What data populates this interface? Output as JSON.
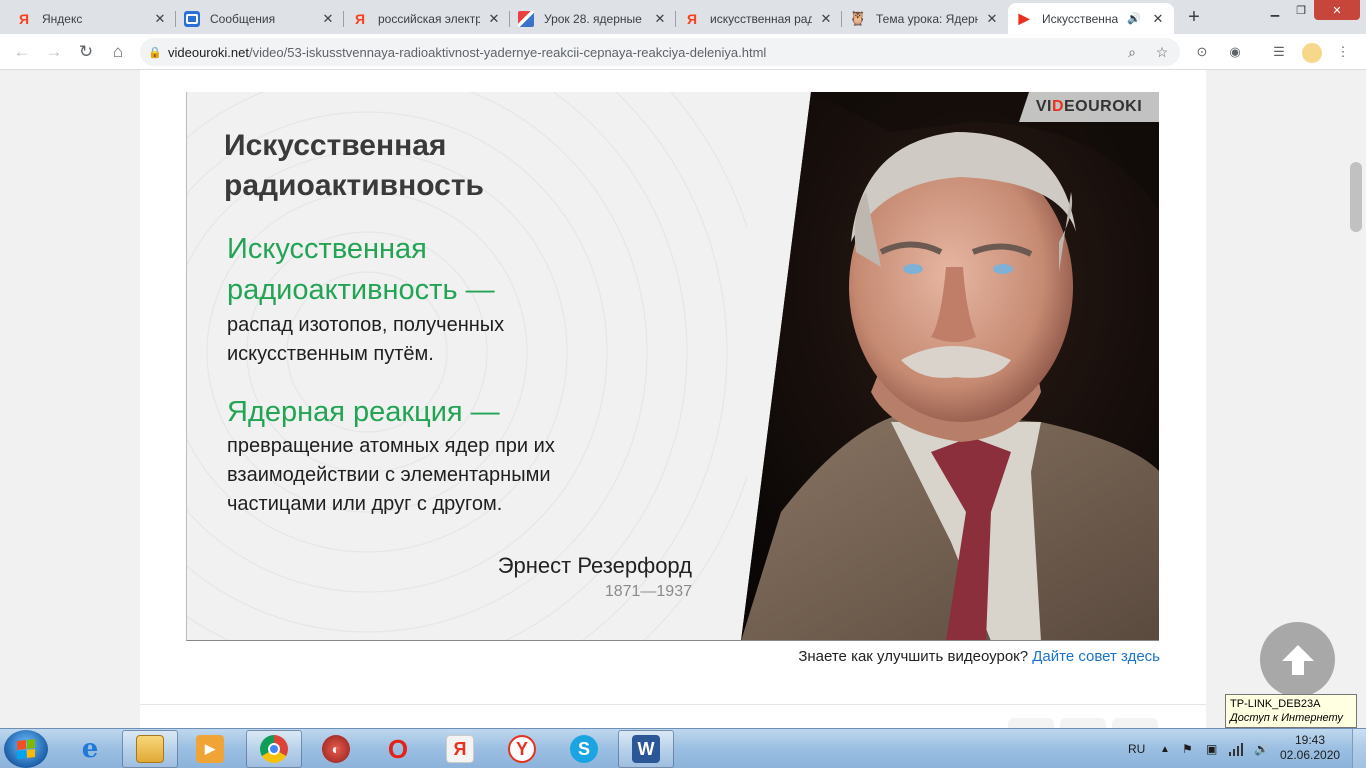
{
  "browser": {
    "tabs": [
      {
        "title": "Яндекс",
        "favicon": "yandex-icon",
        "active": false
      },
      {
        "title": "Сообщения",
        "favicon": "messages-icon",
        "active": false
      },
      {
        "title": "российская электр",
        "favicon": "yandex-icon",
        "active": false
      },
      {
        "title": "Урок 28. ядерные",
        "favicon": "document-icon",
        "active": false
      },
      {
        "title": "искусственная рад",
        "favicon": "yandex-icon",
        "active": false
      },
      {
        "title": "Тема урока: Ядерн",
        "favicon": "owl-icon",
        "active": false
      },
      {
        "title": "Искусственна",
        "favicon": "videouroki-icon",
        "active": true
      }
    ],
    "url_host": "videouroki.net",
    "url_path": "/video/53-iskusstvennaya-radioaktivnost-yadernye-reakcii-cepnaya-reakciya-deleniya.html"
  },
  "slide": {
    "brand_pre": "VI",
    "brand_red": "D",
    "brand_post": "EOUROKI",
    "title_line1": "Искусственная",
    "title_line2": "радиоактивность",
    "term1_line1": "Искусственная",
    "term1_line2": "радиоактивность —",
    "def1_line1": "распад изотопов, полученных",
    "def1_line2": "искусственным путём.",
    "term2": "Ядерная реакция —",
    "def2_line1": "превращение атомных ядер при их",
    "def2_line2": "взаимодействии с элементарными",
    "def2_line3": "частицами или друг с другом.",
    "author": "Эрнест Резерфорд",
    "years": "1871—1937"
  },
  "page": {
    "tip_text": "Знаете как улучшить видеоурок? ",
    "tip_link": "Дайте совет здесь"
  },
  "tooltip": {
    "network": "TP-LINK_DEB23A",
    "status": "Доступ к Интернету"
  },
  "taskbar": {
    "language": "RU",
    "time": "19:43",
    "date": "02.06.2020"
  },
  "colors": {
    "accent_green": "#23a454",
    "link_blue": "#1a73c9",
    "brand_red": "#e8321f"
  }
}
